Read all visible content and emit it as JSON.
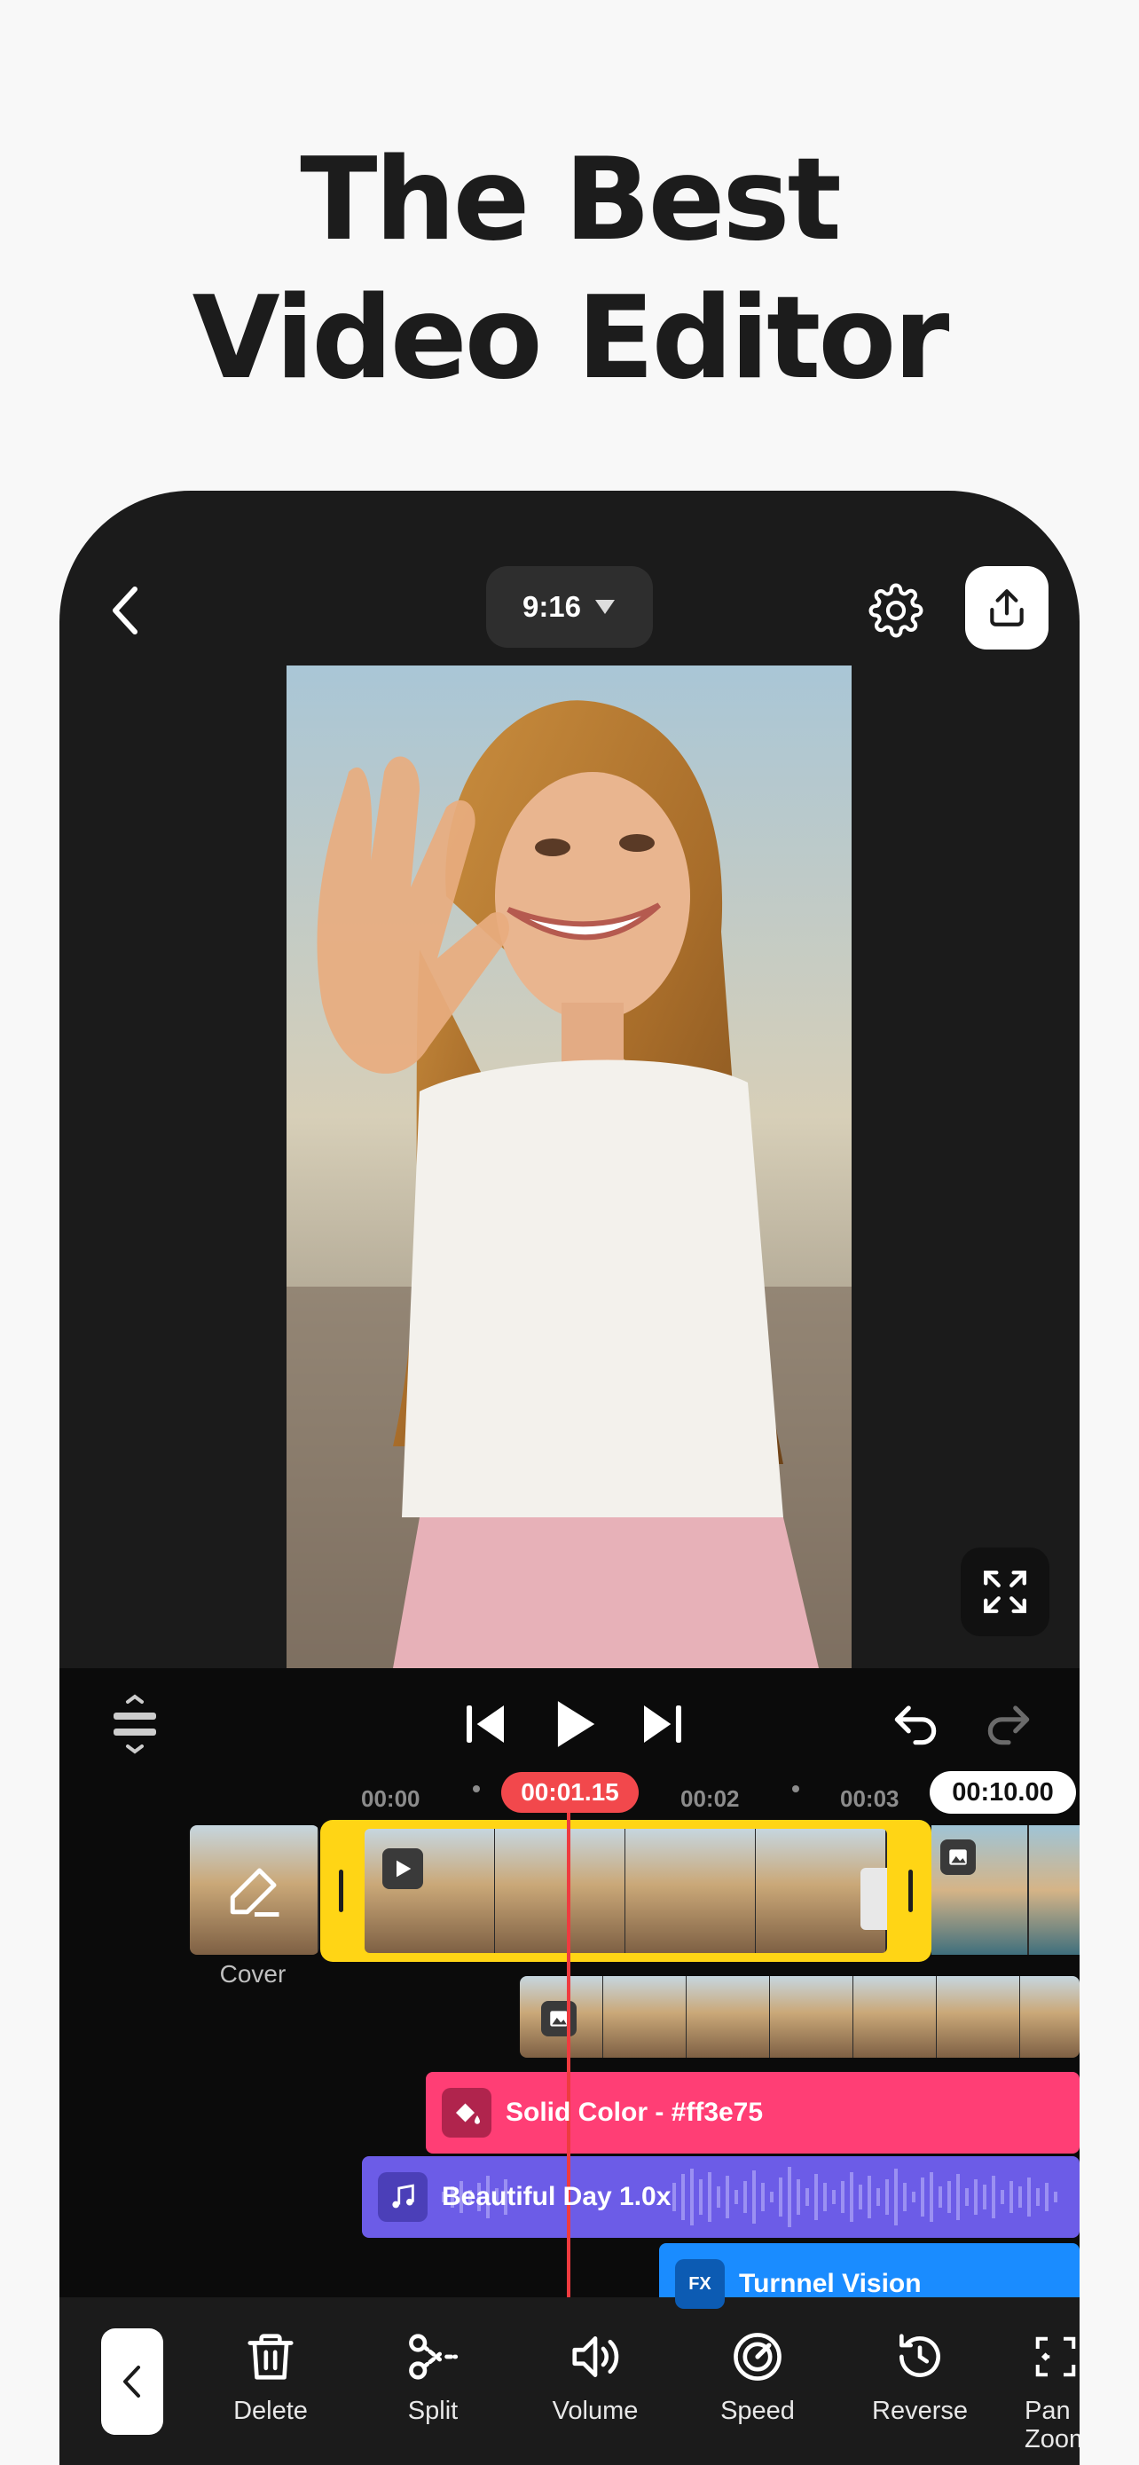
{
  "headline": {
    "line1": "The Best",
    "line2": "Video Editor"
  },
  "topbar": {
    "aspect_ratio": "9:16"
  },
  "ruler": {
    "ticks": [
      "00:00",
      "00:02",
      "00:03"
    ],
    "current_time": "00:01.15",
    "total_time": "00:10.00"
  },
  "cover": {
    "label": "Cover"
  },
  "tracks": {
    "solid_color": {
      "label": "Solid Color - #ff3e75",
      "color": "#ff3e75"
    },
    "music": {
      "label": "Beautiful Day 1.0x",
      "color": "#6c5ce7"
    },
    "effect": {
      "label": "Turnnel Vision",
      "color": "#1a8cff",
      "icon_text": "FX"
    }
  },
  "toolbar": {
    "items": [
      {
        "label": "Delete",
        "icon": "trash-icon"
      },
      {
        "label": "Split",
        "icon": "scissors-icon"
      },
      {
        "label": "Volume",
        "icon": "volume-icon"
      },
      {
        "label": "Speed",
        "icon": "speed-icon"
      },
      {
        "label": "Reverse",
        "icon": "reverse-icon"
      },
      {
        "label": "Pan Zoom",
        "icon": "pan-zoom-icon"
      }
    ]
  },
  "colors": {
    "accent_red": "#f2484c",
    "selected_clip": "#ffd515"
  }
}
